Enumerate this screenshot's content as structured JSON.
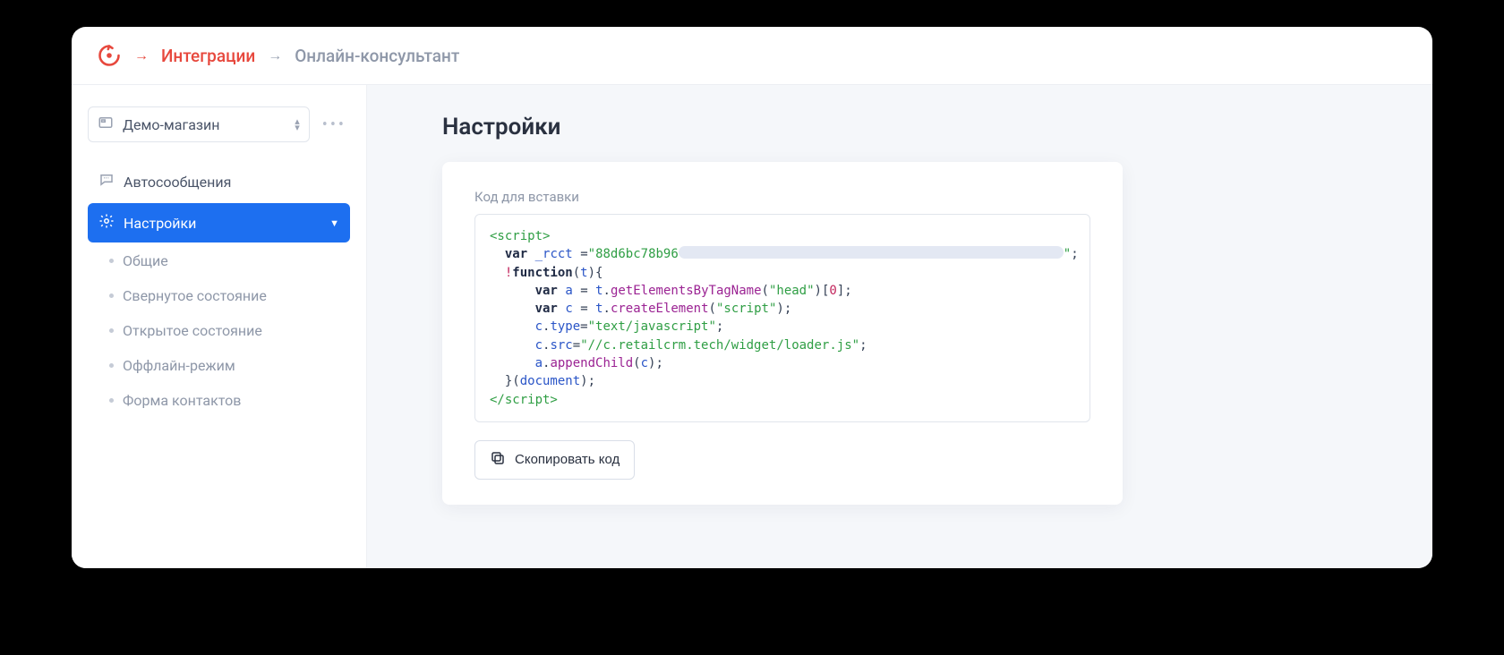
{
  "breadcrumb": {
    "link": "Интеграции",
    "current": "Онлайн-консультант"
  },
  "sidebar": {
    "store_label": "Демо-магазин",
    "items": [
      {
        "label": "Автосообщения"
      },
      {
        "label": "Настройки"
      }
    ],
    "sub_items": [
      {
        "label": "Общие"
      },
      {
        "label": "Свернутое состояние"
      },
      {
        "label": "Открытое состояние"
      },
      {
        "label": "Оффлайн-режим"
      },
      {
        "label": "Форма контактов"
      }
    ]
  },
  "main": {
    "title": "Настройки",
    "code_label": "Код для вставки",
    "copy_button": "Скопировать код",
    "code": {
      "rcct_prefix": "88d6bc78b96",
      "head_tag": "head",
      "script_tag": "script",
      "type_val": "text/javascript",
      "src_val": "//c.retailcrm.tech/widget/loader.js",
      "index": "0"
    }
  }
}
